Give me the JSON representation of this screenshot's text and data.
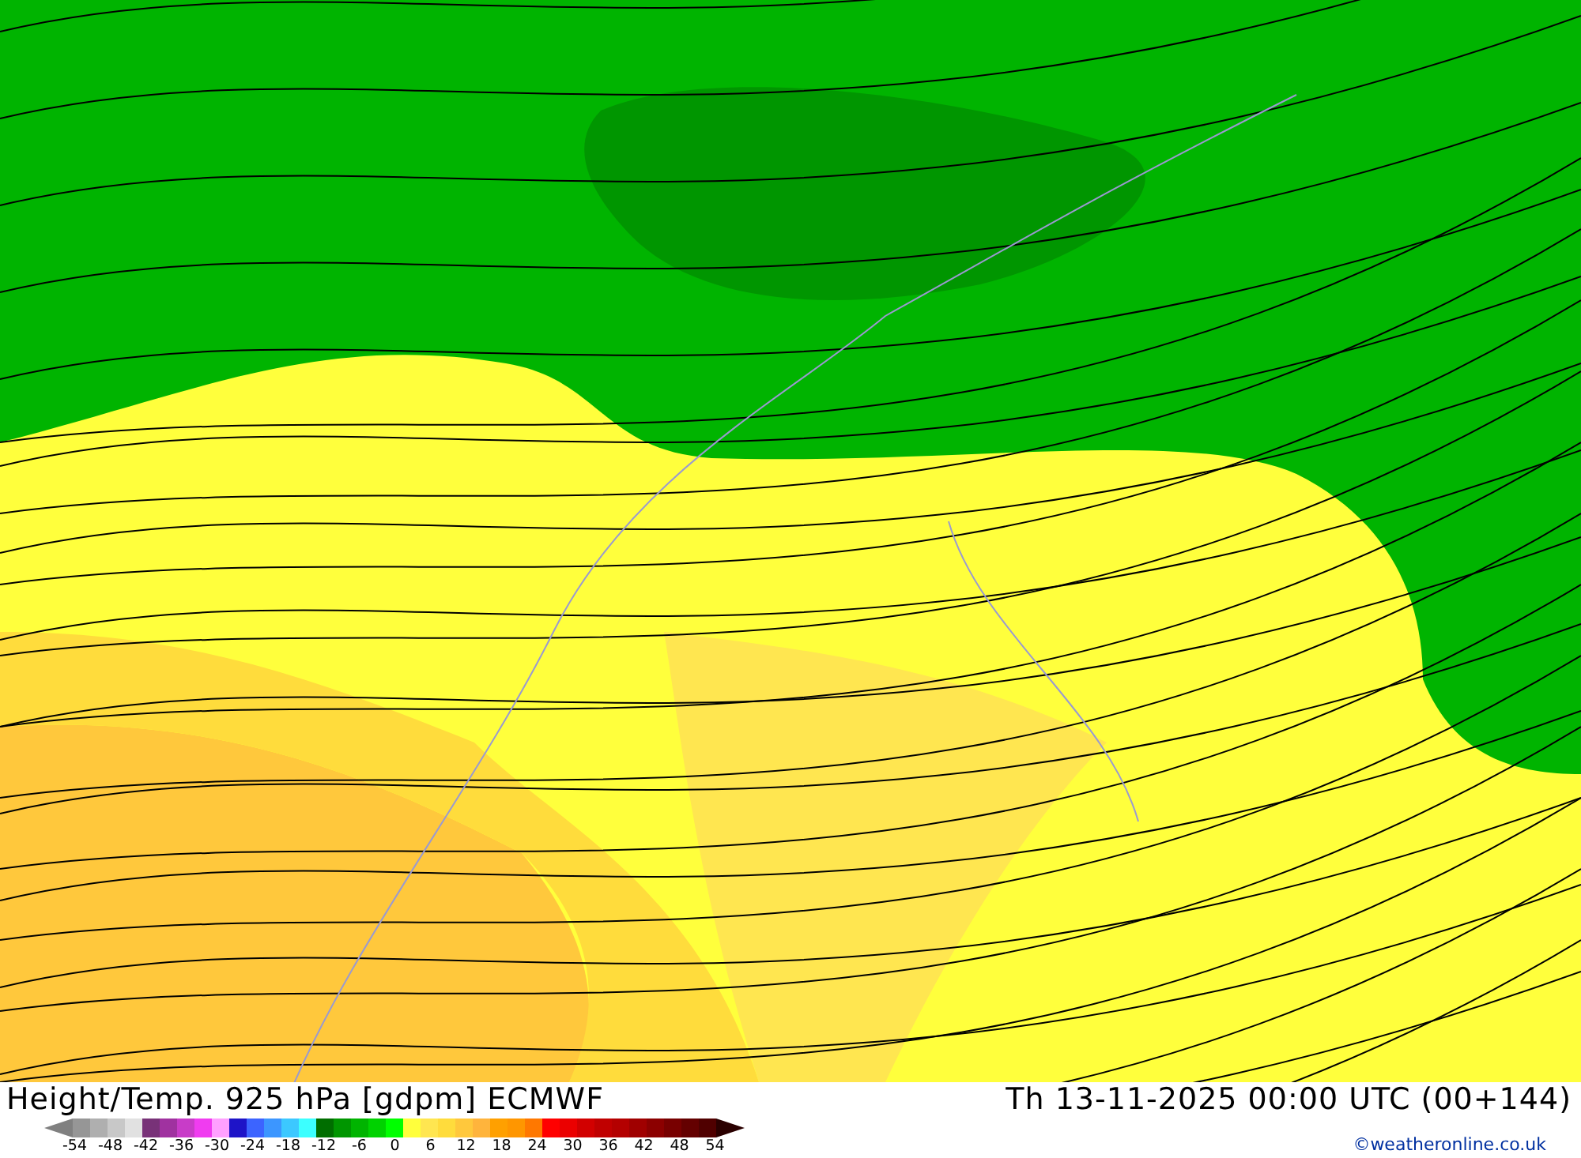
{
  "map": {
    "title": "Height/Temp. 925 hPa [gdpm] ECMWF",
    "valid_time": "Th 13-11-2025 00:00 UTC (00+144)"
  },
  "legend": {
    "swatches": [
      {
        "color": "#969696"
      },
      {
        "color": "#afafaf"
      },
      {
        "color": "#c8c8c8"
      },
      {
        "color": "#e1e1e1"
      },
      {
        "color": "#783278"
      },
      {
        "color": "#a032a0"
      },
      {
        "color": "#c83cc8"
      },
      {
        "color": "#f03cf0"
      },
      {
        "color": "#ffa0ff"
      },
      {
        "color": "#1e14c8"
      },
      {
        "color": "#3c64ff"
      },
      {
        "color": "#3c96ff"
      },
      {
        "color": "#3cc8ff"
      },
      {
        "color": "#3cffff"
      },
      {
        "color": "#006e00"
      },
      {
        "color": "#009600"
      },
      {
        "color": "#00b400"
      },
      {
        "color": "#00d200"
      },
      {
        "color": "#00ff00"
      },
      {
        "color": "#ffff3c"
      },
      {
        "color": "#ffe650"
      },
      {
        "color": "#ffdc3c"
      },
      {
        "color": "#ffc83c"
      },
      {
        "color": "#ffb43c"
      },
      {
        "color": "#ffa000"
      },
      {
        "color": "#ff9600"
      },
      {
        "color": "#ff7800"
      },
      {
        "color": "#ff0000"
      },
      {
        "color": "#eb0000"
      },
      {
        "color": "#d20000"
      },
      {
        "color": "#c00000"
      },
      {
        "color": "#b40000"
      },
      {
        "color": "#a00000"
      },
      {
        "color": "#8c0000"
      },
      {
        "color": "#780000"
      },
      {
        "color": "#640000"
      },
      {
        "color": "#500000"
      }
    ],
    "ticks": [
      "-54",
      "-48",
      "-42",
      "-36",
      "-30",
      "-24",
      "-18",
      "-12",
      "-6",
      "0",
      "6",
      "12",
      "18",
      "24",
      "30",
      "36",
      "42",
      "48",
      "54"
    ]
  },
  "credit": "©weatheronline.co.uk"
}
